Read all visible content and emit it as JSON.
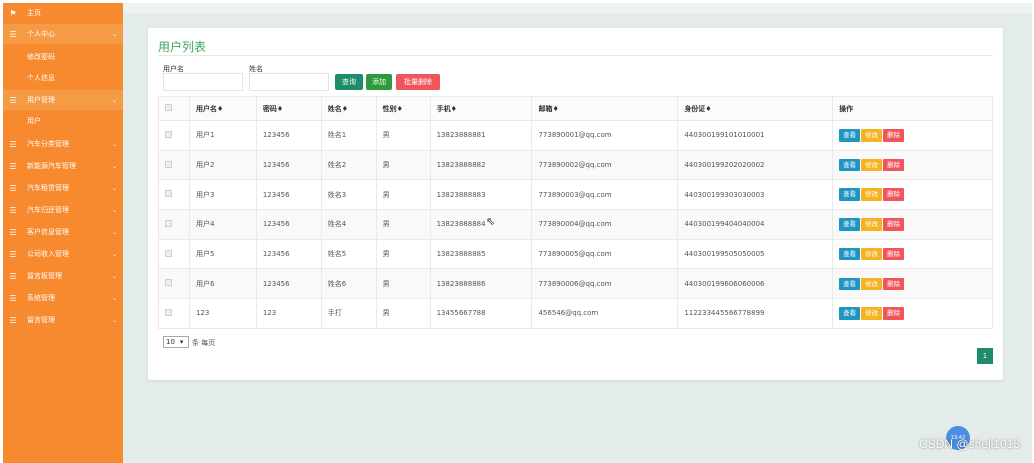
{
  "sidebar": {
    "home": "主页",
    "personal_center": "个人中心",
    "personal_center_sub": [
      "修改密码",
      "个人信息"
    ],
    "user_mgmt": "用户管理",
    "user_mgmt_sub": [
      "用户"
    ],
    "menu": [
      "汽车分类管理",
      "新能源汽车管理",
      "汽车租赁管理",
      "汽车归还管理",
      "客户信息管理",
      "公司收入管理",
      "留言板管理",
      "系统管理",
      "留言管理"
    ]
  },
  "card": {
    "title": "用户列表",
    "filters": {
      "username_label": "用户名",
      "name_label": "姓名"
    },
    "buttons": {
      "query": "查询",
      "add": "添加",
      "batch_delete": "批量删除"
    },
    "table": {
      "headers": [
        "用户名♦",
        "密码♦",
        "姓名♦",
        "性别♦",
        "手机♦",
        "邮箱♦",
        "身份证♦",
        "操作"
      ],
      "rows": [
        [
          "用户1",
          "123456",
          "姓名1",
          "男",
          "13823888881",
          "773890001@qq.com",
          "440300199101010001"
        ],
        [
          "用户2",
          "123456",
          "姓名2",
          "男",
          "13823888882",
          "773890002@qq.com",
          "440300199202020002"
        ],
        [
          "用户3",
          "123456",
          "姓名3",
          "男",
          "13823888883",
          "773890003@qq.com",
          "440300199303030003"
        ],
        [
          "用户4",
          "123456",
          "姓名4",
          "男",
          "13823888884",
          "773890004@qq.com",
          "440300199404040004"
        ],
        [
          "用户5",
          "123456",
          "姓名5",
          "男",
          "13823888885",
          "773890005@qq.com",
          "440300199505050005"
        ],
        [
          "用户6",
          "123456",
          "姓名6",
          "男",
          "13823888886",
          "773890006@qq.com",
          "440300199606060006"
        ],
        [
          "123",
          "123",
          "手打",
          "男",
          "13455667788",
          "456546@qq.com",
          "112233445566778899"
        ]
      ],
      "row_actions": {
        "view": "查看",
        "edit": "修改",
        "delete": "删除"
      }
    },
    "pager": {
      "page_size": "10",
      "per_page_text": "条 每页",
      "current_page": "1"
    }
  },
  "overlay": {
    "watermark": "CSDN @sheji1015",
    "bubble_text": "13:42"
  },
  "colors": {
    "sidebar": "#f7892e",
    "title_green": "#3fa45a",
    "query_button": "#1c8c6a",
    "add_button": "#2e9a3c",
    "batch_delete_button": "#f2545b",
    "view_button": "#1f95c4",
    "edit_button": "#f5b321",
    "delete_button": "#f2545b"
  }
}
